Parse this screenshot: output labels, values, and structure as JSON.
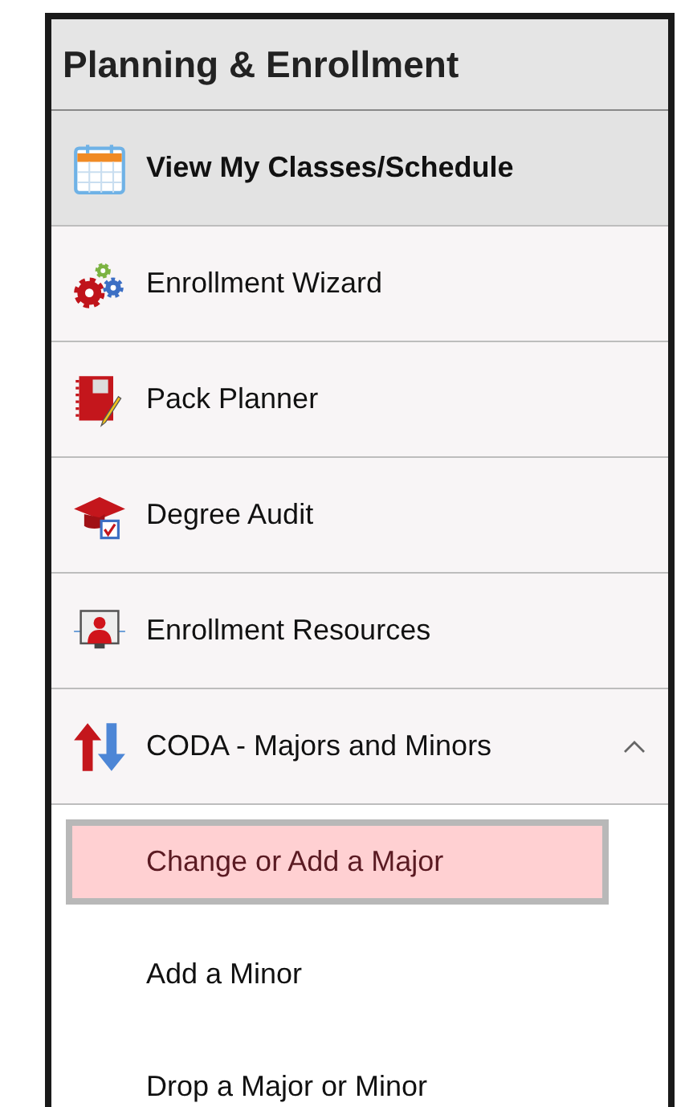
{
  "header": {
    "title": "Planning & Enrollment"
  },
  "menu": [
    {
      "label": "View My Classes/Schedule",
      "kind": "calendar",
      "selected": true
    },
    {
      "label": "Enrollment Wizard",
      "kind": "gears",
      "selected": false
    },
    {
      "label": "Pack Planner",
      "kind": "notebook",
      "selected": false
    },
    {
      "label": "Degree Audit",
      "kind": "cap",
      "selected": false
    },
    {
      "label": "Enrollment Resources",
      "kind": "presenter",
      "selected": false
    },
    {
      "label": "CODA - Majors and Minors",
      "kind": "arrows",
      "selected": false,
      "expanded": true,
      "children": [
        {
          "label": "Change or Add a Major",
          "selected": true
        },
        {
          "label": "Add a Minor",
          "selected": false
        },
        {
          "label": "Drop a Major or Minor",
          "selected": false
        }
      ]
    }
  ]
}
